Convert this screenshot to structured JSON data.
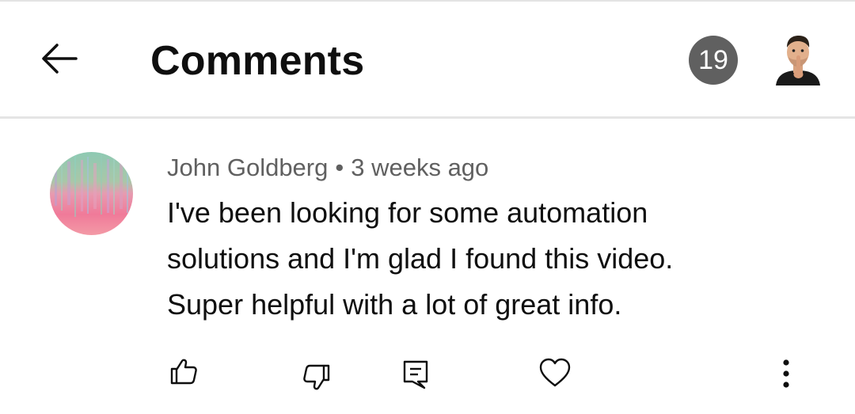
{
  "header": {
    "title": "Comments",
    "comment_count": "19",
    "back_icon": "arrow-left-icon",
    "avatar_icon": "user-avatar"
  },
  "comment": {
    "author": "John Goldberg",
    "separator": "•",
    "time_ago": "3 weeks ago",
    "text_lines": [
      "I've been looking for some automation",
      "solutions and I'm glad I found this video.",
      "Super helpful with a lot of great info."
    ],
    "actions": [
      "thumbs-up-icon",
      "thumbs-down-icon",
      "reply-icon",
      "heart-icon",
      "more-vertical-icon"
    ]
  },
  "colors": {
    "badge_bg": "#606060",
    "meta_text": "#606060",
    "divider": "#e5e5e5"
  }
}
